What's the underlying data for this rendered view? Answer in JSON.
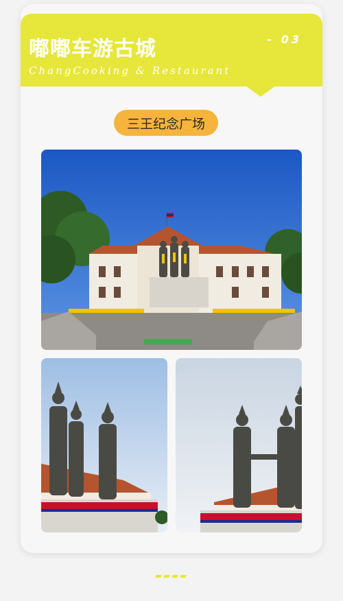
{
  "header": {
    "title": "嘟嘟车游古城",
    "subtitle": "ChangCooking & Restaurant",
    "page_number": "- 03"
  },
  "section": {
    "label": "三王纪念广场"
  },
  "colors": {
    "accent_yellow": "#e7e63a",
    "pill_orange": "#f6b43c",
    "background": "#f3f3f3"
  },
  "photos": [
    {
      "name": "three-kings-monument-wide-photo"
    },
    {
      "name": "three-kings-statues-left-photo"
    },
    {
      "name": "three-kings-statues-right-photo"
    }
  ]
}
